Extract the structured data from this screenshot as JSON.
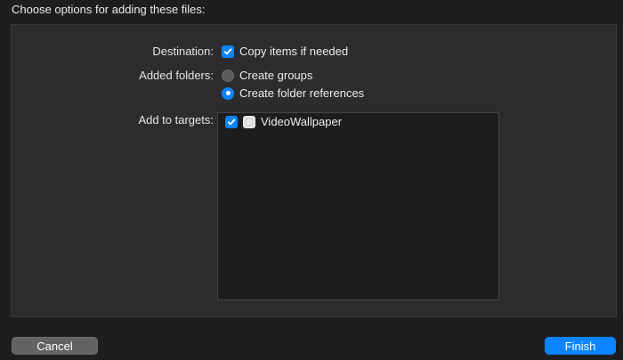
{
  "header": {
    "title": "Choose options for adding these files:"
  },
  "destination": {
    "label": "Destination:",
    "option_label": "Copy items if needed",
    "checked": true
  },
  "added_folders": {
    "label": "Added folders:",
    "options": [
      {
        "label": "Create groups",
        "selected": false
      },
      {
        "label": "Create folder references",
        "selected": true
      }
    ]
  },
  "targets": {
    "label": "Add to targets:",
    "items": [
      {
        "label": "VideoWallpaper",
        "checked": true,
        "icon": "app-icon"
      }
    ]
  },
  "buttons": {
    "cancel_label": "Cancel",
    "finish_label": "Finish"
  },
  "colors": {
    "accent": "#0a84ff",
    "background": "#1e1e20",
    "panel": "#2c2c2e"
  }
}
